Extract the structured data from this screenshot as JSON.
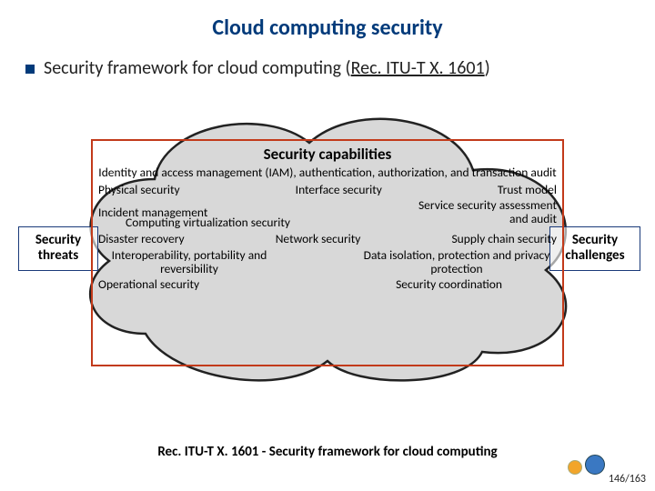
{
  "title": "Cloud computing security",
  "bullet": {
    "text_pre": "Security framework for cloud computing (",
    "ref": "Rec. ITU-T X. 1601",
    "text_post": ")"
  },
  "diagram": {
    "side_left": "Security threats",
    "side_right": "Security challenges",
    "cap_title": "Security capabilities",
    "cap_sub": "Identity and access management (IAM), authentication, authorization, and transaction audit",
    "items": {
      "physical": "Physical security",
      "interface": "Interface security",
      "trust": "Trust model",
      "incident": "Incident management",
      "service_audit": "Service security assessment and audit",
      "virt": "Computing virtualization security",
      "disaster": "Disaster recovery",
      "network": "Network security",
      "supply": "Supply chain security",
      "interop": "Interoperability, portability and reversibility",
      "isolation": "Data isolation, protection and privacy protection",
      "operational": "Operational security",
      "coord": "Security coordination"
    }
  },
  "caption": "Rec. ITU-T X. 1601 - Security framework for cloud computing",
  "page": "146/163"
}
